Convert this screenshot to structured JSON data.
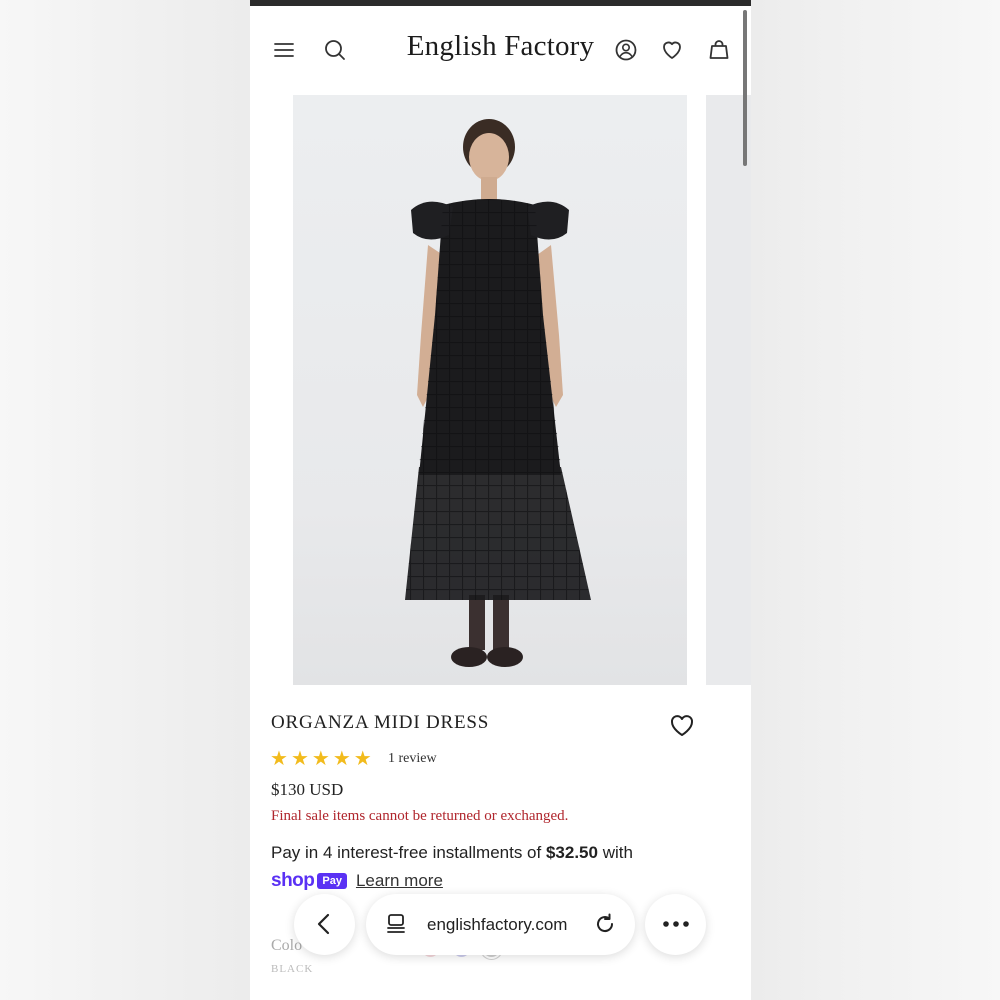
{
  "header": {
    "brand": "English Factory",
    "icons": [
      "menu-icon",
      "search-icon",
      "account-icon",
      "heart-icon",
      "bag-icon"
    ]
  },
  "product": {
    "title": "ORGANZA MIDI DRESS",
    "rating": 5,
    "review_count": "1 review",
    "price": "$130 USD",
    "final_sale_notice": "Final sale items cannot be returned or exchanged.",
    "installments_prefix": "Pay in 4 interest-free installments of ",
    "installments_amount": "$32.50",
    "installments_suffix": " with",
    "shop_pay_word": "shop",
    "shop_pay_badge": "Pay",
    "learn_more": "Learn more",
    "color_label": "Colo",
    "color_value": "BLACK"
  },
  "browser": {
    "url": "englishfactory.com"
  },
  "colors": {
    "final_sale_text": "#b0262d",
    "shop_pay_purple": "#5a31f4",
    "star": "#f2bb1c",
    "dress": "#1b1b1d"
  }
}
